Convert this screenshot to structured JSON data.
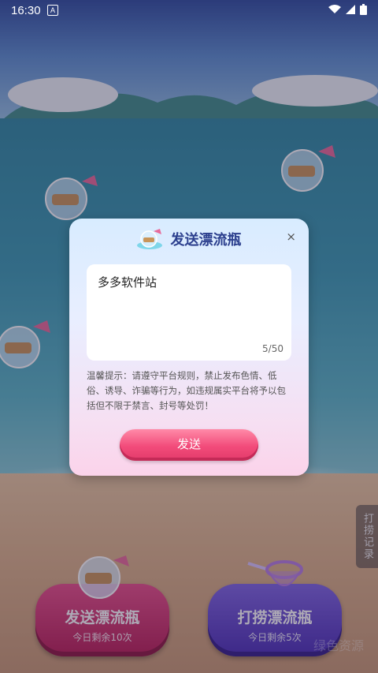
{
  "status_bar": {
    "time": "16:30",
    "notification_letter": "A"
  },
  "side_tab": {
    "label": "打捞记录"
  },
  "bottom_buttons": [
    {
      "title": "发送漂流瓶",
      "subtitle": "今日剩余10次"
    },
    {
      "title": "打捞漂流瓶",
      "subtitle": "今日剩余5次"
    }
  ],
  "watermark": "绿色资源",
  "modal": {
    "title": "发送漂流瓶",
    "close_symbol": "×",
    "message_value": "多多软件站",
    "counter": "5/50",
    "notice": "温馨提示：请遵守平台规则，禁止发布色情、低俗、诱导、诈骗等行为，如违规属实平台将予以包括但不限于禁言、封号等处罚！",
    "send_label": "发送"
  },
  "colors": {
    "modal_title": "#2c3f8e",
    "send_button": "#f24b7a",
    "send_bottle_button": "#c92a63",
    "fish_bottle_button": "#5a3fc8"
  }
}
